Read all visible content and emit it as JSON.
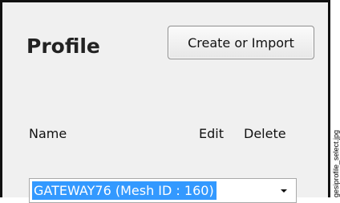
{
  "profile": {
    "title": "Profile",
    "create_import_label": "Create or Import"
  },
  "columns": {
    "name": "Name",
    "edit": "Edit",
    "delete": "Delete"
  },
  "profile_select": {
    "selected_value": "GATEWAY76 (Mesh ID : 160)",
    "arrow_icon": "chevron-down-icon",
    "selection_color": "#3399ff"
  },
  "side_caption": "gesiprofile_select.jpg"
}
